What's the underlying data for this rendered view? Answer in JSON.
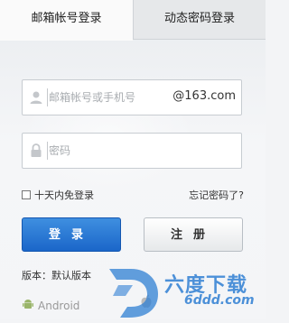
{
  "tabs": {
    "mail_login": "邮箱帐号登录",
    "dynamic_login": "动态密码登录"
  },
  "username": {
    "placeholder": "邮箱帐号或手机号",
    "domain_suffix": "@163.com"
  },
  "password": {
    "placeholder": "密码"
  },
  "remember_label": "十天内免登录",
  "forgot_label": "忘记密码了?",
  "login_button": "登录",
  "register_button": "注册",
  "version_label": "版本：默认版本",
  "android_label": "Android",
  "watermark": {
    "title": "六度下载",
    "url": "6ddd.com"
  }
}
